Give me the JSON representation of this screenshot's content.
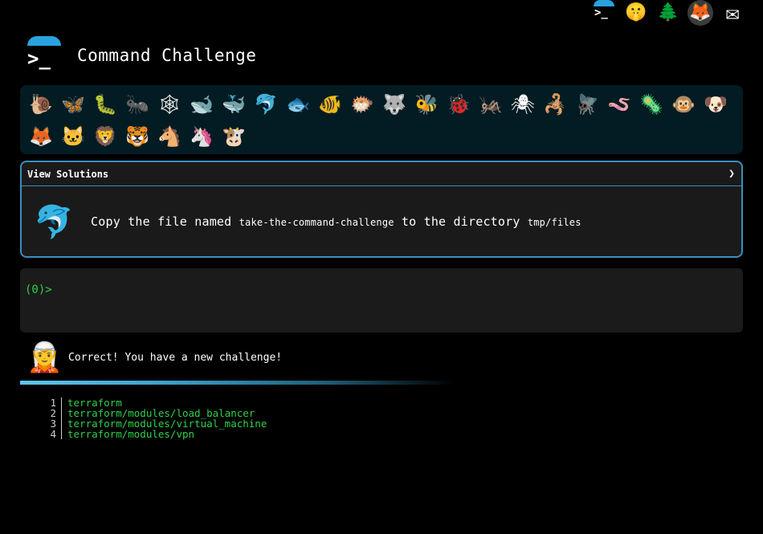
{
  "top_icons": [
    {
      "name": "prompt-logo-icon",
      "glyph": ">_",
      "interactable": true
    },
    {
      "name": "shushing-face-icon",
      "glyph": "🤫",
      "interactable": true
    },
    {
      "name": "tree-icon",
      "glyph": "🌲",
      "interactable": true
    },
    {
      "name": "gitlab-icon",
      "glyph": "🦊",
      "interactable": true
    },
    {
      "name": "mail-icon",
      "glyph": "✉",
      "interactable": true
    }
  ],
  "header": {
    "logo_glyph": ">_",
    "title": "Command Challenge"
  },
  "animals": [
    {
      "name": "snail-icon",
      "glyph": "🐌"
    },
    {
      "name": "butterfly-icon",
      "glyph": "🦋"
    },
    {
      "name": "caterpillar-icon",
      "glyph": "🐛"
    },
    {
      "name": "ant-icon",
      "glyph": "🐜"
    },
    {
      "name": "spider-web-icon",
      "glyph": "🕸"
    },
    {
      "name": "whale-icon",
      "glyph": "🐋"
    },
    {
      "name": "spouting-whale-icon",
      "glyph": "🐳"
    },
    {
      "name": "dolphin-icon",
      "glyph": "🐬"
    },
    {
      "name": "fish-icon",
      "glyph": "🐟"
    },
    {
      "name": "tropical-fish-icon",
      "glyph": "🐠"
    },
    {
      "name": "blowfish-icon",
      "glyph": "🐡"
    },
    {
      "name": "wolf-icon",
      "glyph": "🐺"
    },
    {
      "name": "bee-icon",
      "glyph": "🐝"
    },
    {
      "name": "ladybug-icon",
      "glyph": "🐞"
    },
    {
      "name": "cricket-icon",
      "glyph": "🦗"
    },
    {
      "name": "spider-icon",
      "glyph": "🕷"
    },
    {
      "name": "scorpion-icon",
      "glyph": "🦂"
    },
    {
      "name": "fly-icon",
      "glyph": "🪰"
    },
    {
      "name": "worm-icon",
      "glyph": "🪱"
    },
    {
      "name": "microbe-icon",
      "glyph": "🦠"
    },
    {
      "name": "monkey-icon",
      "glyph": "🐵"
    },
    {
      "name": "dog-icon",
      "glyph": "🐶"
    },
    {
      "name": "fox-icon",
      "glyph": "🦊"
    },
    {
      "name": "cat-icon",
      "glyph": "🐱"
    },
    {
      "name": "lion-icon",
      "glyph": "🦁"
    },
    {
      "name": "tiger-icon",
      "glyph": "🐯"
    },
    {
      "name": "horse-icon",
      "glyph": "🐴"
    },
    {
      "name": "unicorn-icon",
      "glyph": "🦄"
    },
    {
      "name": "cow-icon",
      "glyph": "🐮"
    }
  ],
  "solutions": {
    "label": "View Solutions",
    "chevron": "❯"
  },
  "challenge": {
    "icon": "🐬",
    "text_before": "Copy the file named ",
    "file": "take-the-command-challenge",
    "text_middle": " to the directory ",
    "directory": "tmp/files"
  },
  "terminal": {
    "prompt": "(0)>"
  },
  "status": {
    "avatar": "🧝",
    "message": "Correct! You have a new challenge!"
  },
  "tree": [
    {
      "num": "1",
      "path": "terraform"
    },
    {
      "num": "2",
      "path": "terraform/modules/load_balancer"
    },
    {
      "num": "3",
      "path": "terraform/modules/virtual_machine"
    },
    {
      "num": "4",
      "path": "terraform/modules/vpn"
    }
  ]
}
